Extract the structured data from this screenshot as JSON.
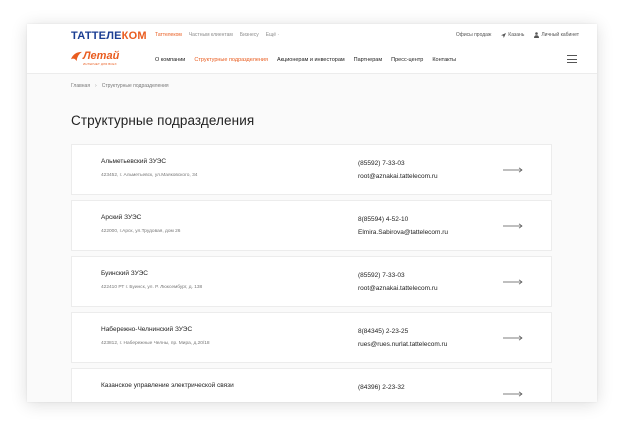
{
  "header": {
    "brand_main": "ТАТТЕЛЕ",
    "brand_accent": "КОМ",
    "top_links": [
      {
        "label": "Таттелеком",
        "active": true
      },
      {
        "label": "Частным клиентам",
        "active": false
      },
      {
        "label": "Бизнесу",
        "active": false
      },
      {
        "label": "Ещё ·",
        "active": false
      }
    ],
    "offices_label": "Офисы продаж",
    "city_label": "Казань",
    "cabinet_label": "Личный кабинет"
  },
  "nav": {
    "logo_text": "Летай",
    "logo_sub": "ИНТЕРНЕТ ДЛЯ ВСЕХ",
    "items": [
      {
        "label": "О компании",
        "active": false
      },
      {
        "label": "Структурные подразделения",
        "active": true
      },
      {
        "label": "Акционерам и инвесторам",
        "active": false
      },
      {
        "label": "Партнерам",
        "active": false
      },
      {
        "label": "Пресс-центр",
        "active": false
      },
      {
        "label": "Контакты",
        "active": false
      }
    ]
  },
  "breadcrumb": {
    "home": "Главная",
    "separator": "›",
    "current": "Структурные подразделения"
  },
  "page_title": "Структурные подразделения",
  "units": [
    {
      "name": "Альметьевский ЗУЭС",
      "address": "423452, г. Альметьевск, ул.Маяковского, 34",
      "phone": "(85592) 7-33-03",
      "email": "root@aznakai.tattelecom.ru"
    },
    {
      "name": "Арский ЗУЭС",
      "address": "422000, г.Арск, ул.Трудовая, дом 26",
      "phone": "8(85594) 4-52-10",
      "email": "Elmira.Sabirova@tattelecom.ru"
    },
    {
      "name": "Буинский ЗУЭС",
      "address": "422410 РТ г. Буинск, ул. Р. Люксембург, д. 138",
      "phone": "(85592) 7-33-03",
      "email": "root@aznakai.tattelecom.ru"
    },
    {
      "name": "Набережно-Челнинский ЗУЭС",
      "address": "423812, г. Набережные Челны, пр. Мира, д.20/18",
      "phone": "8(84345) 2-23-25",
      "email": "rues@rues.nurlat.tattelecom.ru"
    },
    {
      "name": "Казанское управление электрической связи",
      "address": "",
      "phone": "(84396) 2-23-32",
      "email": ""
    }
  ],
  "colors": {
    "accent": "#e95c1f",
    "brand_blue": "#1b3e93"
  }
}
